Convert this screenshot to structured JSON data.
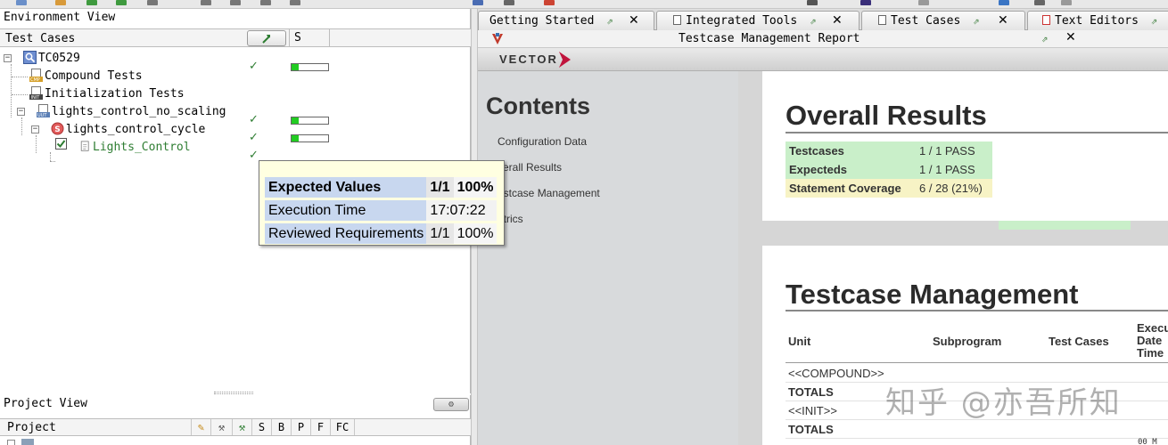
{
  "env_view": {
    "title": "Environment View",
    "column_header": "Test Cases",
    "status_column": "S",
    "tree": [
      {
        "label": "TC0529",
        "status_check": "✓",
        "progress": 0.2
      },
      {
        "label": "Compound Tests"
      },
      {
        "label": "Initialization Tests"
      },
      {
        "label": "lights_control_no_scaling",
        "status_check": "✓",
        "progress": 0.2
      },
      {
        "label": "lights_control_cycle",
        "status_check": "✓",
        "progress": 0.2
      },
      {
        "label": "Lights_Control",
        "status_check": "✓"
      }
    ]
  },
  "tooltip": {
    "rows": [
      {
        "name": "Expected Values",
        "num": "1/1",
        "pct": "100%"
      },
      {
        "name": "Execution Time",
        "num": "17:07:22",
        "pct": ""
      },
      {
        "name": "Reviewed Requirements",
        "num": "1/1",
        "pct": "100%"
      }
    ]
  },
  "project_view": {
    "title": "Project View",
    "column_header": "Project",
    "columns": [
      "S",
      "B",
      "P",
      "F",
      "FC"
    ]
  },
  "editor_tabs": [
    {
      "label": "Getting Started"
    },
    {
      "label": "Integrated Tools"
    },
    {
      "label": "Test Cases"
    },
    {
      "label": "Text Editors"
    }
  ],
  "report": {
    "title": "Testcase Management Report",
    "brand": "VECTOR",
    "contents_heading": "Contents",
    "toc": [
      "Configuration Data",
      "verall Results",
      "estcase Management",
      "etrics"
    ],
    "overall": {
      "heading": "Overall Results",
      "rows": [
        {
          "key": "Testcases",
          "value": "1 / 1 PASS"
        },
        {
          "key": "Expecteds",
          "value": "1 / 1 PASS"
        },
        {
          "key": "Statement Coverage",
          "value": "6 / 28 (21%)"
        }
      ]
    },
    "testcase_mgmt": {
      "heading": "Testcase Management",
      "columns": {
        "unit": "Unit",
        "subprogram": "Subprogram",
        "test_cases": "Test Cases",
        "exec_1": "Execu",
        "exec_2": "Date",
        "exec_3": "Time"
      },
      "rows": [
        "<<COMPOUND>>",
        "TOTALS",
        "<<INIT>>",
        "TOTALS"
      ],
      "cut_text": "00 M"
    }
  },
  "watermark": "知乎 @亦吾所知",
  "colors": {
    "pass_green": "#c9efc9",
    "coverage_yellow": "#f7f3c5",
    "progress_green": "#22cc22",
    "tooltip_bg": "#ffffe1"
  }
}
